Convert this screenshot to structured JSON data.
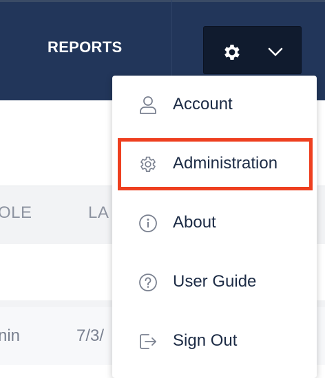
{
  "nav": {
    "reports_label": "REPORTS",
    "settings_icon": "gear-icon",
    "dropdown_icon": "chevron-down-icon"
  },
  "table": {
    "columns": [
      "OLE",
      "LA"
    ],
    "rows": [
      {
        "role": "nin",
        "date": "7/3/"
      }
    ]
  },
  "menu": {
    "items": [
      {
        "label": "Account",
        "icon": "user-icon"
      },
      {
        "label": "Administration",
        "icon": "gear-outline-icon"
      },
      {
        "label": "About",
        "icon": "info-icon"
      },
      {
        "label": "User Guide",
        "icon": "question-icon"
      },
      {
        "label": "Sign Out",
        "icon": "sign-out-icon"
      }
    ]
  },
  "highlight": {
    "target": "Administration",
    "color": "#ee3f1f"
  },
  "colors": {
    "navbar": "#22365a",
    "button": "#101b2e",
    "text": "#1c2b45",
    "icon": "#7a8190"
  }
}
